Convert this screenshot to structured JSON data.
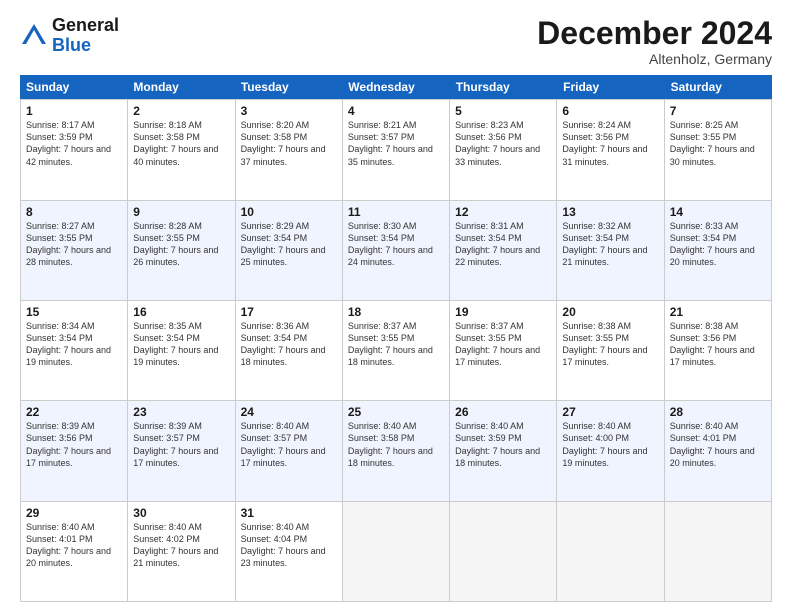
{
  "header": {
    "logo_general": "General",
    "logo_blue": "Blue",
    "month_title": "December 2024",
    "location": "Altenholz, Germany"
  },
  "days_of_week": [
    "Sunday",
    "Monday",
    "Tuesday",
    "Wednesday",
    "Thursday",
    "Friday",
    "Saturday"
  ],
  "weeks": [
    [
      {
        "day": "1",
        "sunrise": "8:17 AM",
        "sunset": "3:59 PM",
        "daylight": "7 hours and 42 minutes."
      },
      {
        "day": "2",
        "sunrise": "8:18 AM",
        "sunset": "3:58 PM",
        "daylight": "7 hours and 40 minutes."
      },
      {
        "day": "3",
        "sunrise": "8:20 AM",
        "sunset": "3:58 PM",
        "daylight": "7 hours and 37 minutes."
      },
      {
        "day": "4",
        "sunrise": "8:21 AM",
        "sunset": "3:57 PM",
        "daylight": "7 hours and 35 minutes."
      },
      {
        "day": "5",
        "sunrise": "8:23 AM",
        "sunset": "3:56 PM",
        "daylight": "7 hours and 33 minutes."
      },
      {
        "day": "6",
        "sunrise": "8:24 AM",
        "sunset": "3:56 PM",
        "daylight": "7 hours and 31 minutes."
      },
      {
        "day": "7",
        "sunrise": "8:25 AM",
        "sunset": "3:55 PM",
        "daylight": "7 hours and 30 minutes."
      }
    ],
    [
      {
        "day": "8",
        "sunrise": "8:27 AM",
        "sunset": "3:55 PM",
        "daylight": "7 hours and 28 minutes."
      },
      {
        "day": "9",
        "sunrise": "8:28 AM",
        "sunset": "3:55 PM",
        "daylight": "7 hours and 26 minutes."
      },
      {
        "day": "10",
        "sunrise": "8:29 AM",
        "sunset": "3:54 PM",
        "daylight": "7 hours and 25 minutes."
      },
      {
        "day": "11",
        "sunrise": "8:30 AM",
        "sunset": "3:54 PM",
        "daylight": "7 hours and 24 minutes."
      },
      {
        "day": "12",
        "sunrise": "8:31 AM",
        "sunset": "3:54 PM",
        "daylight": "7 hours and 22 minutes."
      },
      {
        "day": "13",
        "sunrise": "8:32 AM",
        "sunset": "3:54 PM",
        "daylight": "7 hours and 21 minutes."
      },
      {
        "day": "14",
        "sunrise": "8:33 AM",
        "sunset": "3:54 PM",
        "daylight": "7 hours and 20 minutes."
      }
    ],
    [
      {
        "day": "15",
        "sunrise": "8:34 AM",
        "sunset": "3:54 PM",
        "daylight": "7 hours and 19 minutes."
      },
      {
        "day": "16",
        "sunrise": "8:35 AM",
        "sunset": "3:54 PM",
        "daylight": "7 hours and 19 minutes."
      },
      {
        "day": "17",
        "sunrise": "8:36 AM",
        "sunset": "3:54 PM",
        "daylight": "7 hours and 18 minutes."
      },
      {
        "day": "18",
        "sunrise": "8:37 AM",
        "sunset": "3:55 PM",
        "daylight": "7 hours and 18 minutes."
      },
      {
        "day": "19",
        "sunrise": "8:37 AM",
        "sunset": "3:55 PM",
        "daylight": "7 hours and 17 minutes."
      },
      {
        "day": "20",
        "sunrise": "8:38 AM",
        "sunset": "3:55 PM",
        "daylight": "7 hours and 17 minutes."
      },
      {
        "day": "21",
        "sunrise": "8:38 AM",
        "sunset": "3:56 PM",
        "daylight": "7 hours and 17 minutes."
      }
    ],
    [
      {
        "day": "22",
        "sunrise": "8:39 AM",
        "sunset": "3:56 PM",
        "daylight": "7 hours and 17 minutes."
      },
      {
        "day": "23",
        "sunrise": "8:39 AM",
        "sunset": "3:57 PM",
        "daylight": "7 hours and 17 minutes."
      },
      {
        "day": "24",
        "sunrise": "8:40 AM",
        "sunset": "3:57 PM",
        "daylight": "7 hours and 17 minutes."
      },
      {
        "day": "25",
        "sunrise": "8:40 AM",
        "sunset": "3:58 PM",
        "daylight": "7 hours and 18 minutes."
      },
      {
        "day": "26",
        "sunrise": "8:40 AM",
        "sunset": "3:59 PM",
        "daylight": "7 hours and 18 minutes."
      },
      {
        "day": "27",
        "sunrise": "8:40 AM",
        "sunset": "4:00 PM",
        "daylight": "7 hours and 19 minutes."
      },
      {
        "day": "28",
        "sunrise": "8:40 AM",
        "sunset": "4:01 PM",
        "daylight": "7 hours and 20 minutes."
      }
    ],
    [
      {
        "day": "29",
        "sunrise": "8:40 AM",
        "sunset": "4:01 PM",
        "daylight": "7 hours and 20 minutes."
      },
      {
        "day": "30",
        "sunrise": "8:40 AM",
        "sunset": "4:02 PM",
        "daylight": "7 hours and 21 minutes."
      },
      {
        "day": "31",
        "sunrise": "8:40 AM",
        "sunset": "4:04 PM",
        "daylight": "7 hours and 23 minutes."
      },
      null,
      null,
      null,
      null
    ]
  ],
  "labels": {
    "sunrise": "Sunrise:",
    "sunset": "Sunset:",
    "daylight": "Daylight:"
  }
}
